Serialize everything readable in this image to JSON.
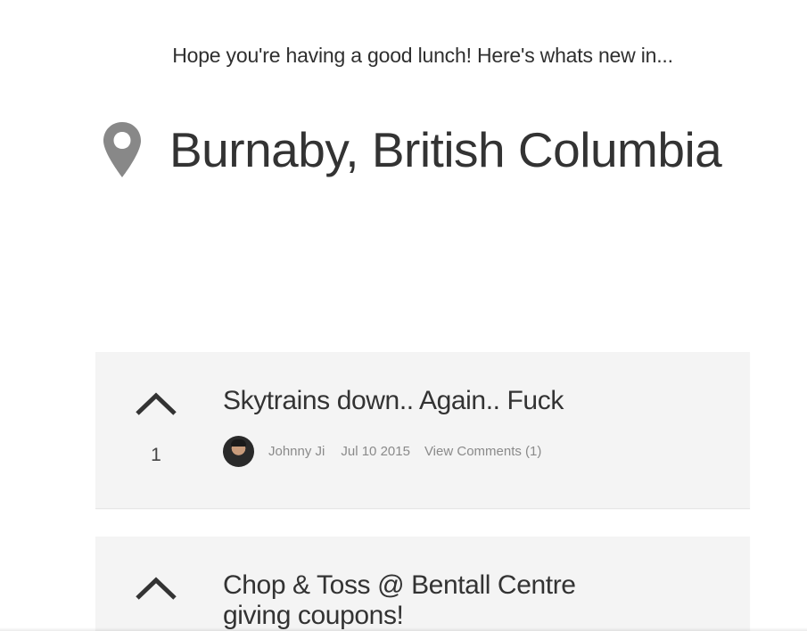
{
  "header": {
    "greeting": "Hope you're having a good lunch! Here's whats new in...",
    "location": "Burnaby, British Columbia",
    "location_icon": "map-pin-icon"
  },
  "colors": {
    "card_background": "#f4f4f4",
    "text_primary": "#333333",
    "text_meta": "#8a8a8a",
    "icon_gray": "#888888"
  },
  "posts": [
    {
      "title": "Skytrains down.. Again.. Fuck",
      "votes": "1",
      "author": "Johnny Ji",
      "date": "Jul 10 2015",
      "comments_label": "View Comments (1)"
    },
    {
      "title": "Chop & Toss @ Bentall Centre giving coupons!"
    }
  ]
}
